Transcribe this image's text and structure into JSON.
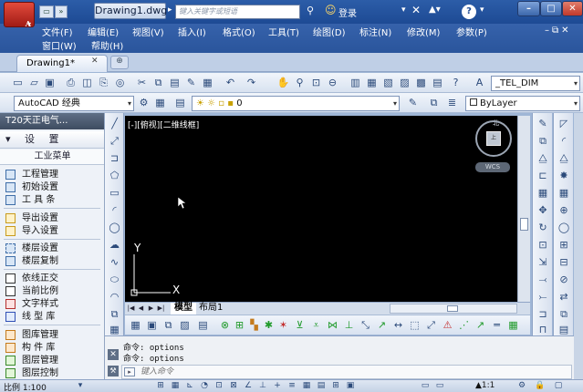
{
  "title_bar": {
    "logo_letter": "A",
    "document_title": "Drawing1.dwg",
    "search_placeholder": "键入关键字或短语",
    "login_label": "登录",
    "help_label": "?"
  },
  "menu": {
    "row1": [
      "文件(F)",
      "编辑(E)",
      "视图(V)",
      "插入(I)",
      "格式(O)",
      "工具(T)",
      "绘图(D)",
      "标注(N)",
      "修改(M)",
      "参数(P)"
    ],
    "row2": [
      "窗口(W)",
      "帮助(H)"
    ]
  },
  "tabs": {
    "active_tab": "Drawing1*"
  },
  "toolbar": {
    "dimstyle": "_TEL_DIM",
    "workspace": "AutoCAD 经典",
    "layer": "0",
    "linetype": "ByLayer"
  },
  "palette": {
    "title": "T20天正电气...",
    "section": "设 置",
    "sub_header": "工业菜单",
    "items": [
      "工程管理",
      "初始设置",
      "工 具 条",
      "导出设置",
      "导入设置",
      "楼层设置",
      "楼层复制",
      "依线正交",
      "当前比例",
      "文字样式",
      "线 型 库",
      "图库管理",
      "构 件 库",
      "图层管理",
      "图层控制"
    ]
  },
  "canvas": {
    "viewport_label": "[-][俯视][二维线框]",
    "viewcube_top": "上",
    "viewcube_north": "北",
    "wcs_label": "WCS",
    "axis_y": "Y",
    "axis_x": "X"
  },
  "layout_tabs": {
    "model": "模型",
    "layout1": "布局1"
  },
  "command": {
    "history": [
      "命令: options",
      "命令: options"
    ],
    "input_placeholder": "键入命令"
  },
  "status": {
    "scale": "比例 1:100",
    "annotation_scale": "1:1"
  }
}
